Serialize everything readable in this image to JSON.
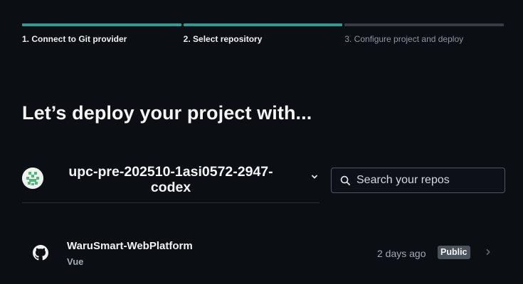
{
  "stepper": {
    "steps": [
      {
        "label": "1. Connect to Git provider",
        "state": "complete"
      },
      {
        "label": "2. Select repository",
        "state": "active"
      },
      {
        "label": "3. Configure project and deploy",
        "state": "upcoming"
      }
    ],
    "colors": {
      "active": "#2e9c96",
      "inactive": "#383d45"
    }
  },
  "heading": "Let’s deploy your project with...",
  "account": {
    "name": "upc-pre-202510-1asi0572-2947-codex",
    "avatar_icon": "identicon-avatar",
    "dropdown_icon": "chevron-down-icon"
  },
  "search": {
    "placeholder": "Search your repos",
    "value": "",
    "icon": "search-icon"
  },
  "repos": [
    {
      "name": "WaruSmart-WebPlatform",
      "framework": "Vue",
      "updated": "2 days ago",
      "visibility": "Public",
      "icon": "github-icon"
    }
  ]
}
